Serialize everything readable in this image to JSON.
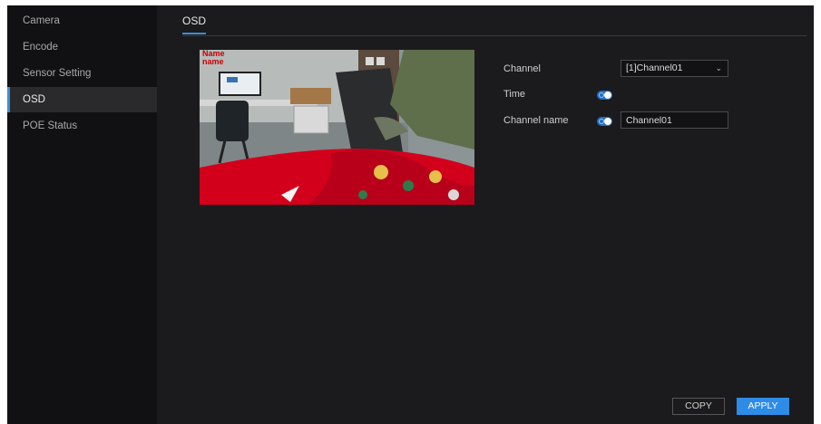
{
  "sidebar": {
    "items": [
      {
        "label": "Camera",
        "active": false
      },
      {
        "label": "Encode",
        "active": false
      },
      {
        "label": "Sensor Setting",
        "active": false
      },
      {
        "label": "OSD",
        "active": true
      },
      {
        "label": "POE Status",
        "active": false
      }
    ]
  },
  "main": {
    "tab": "OSD",
    "preview": {
      "overlay_text": "Name\nname"
    },
    "form": {
      "channel_label": "Channel",
      "channel_value": "[1]Channel01",
      "time_label": "Time",
      "time_enabled": true,
      "channel_name_label": "Channel name",
      "channel_name_enabled": true,
      "channel_name_value": "Channel01"
    },
    "buttons": {
      "copy": "COPY",
      "apply": "APPLY"
    }
  },
  "colors": {
    "accent": "#2e8be6",
    "sidebar_bg": "#111113",
    "panel_bg": "#1b1b1d"
  }
}
